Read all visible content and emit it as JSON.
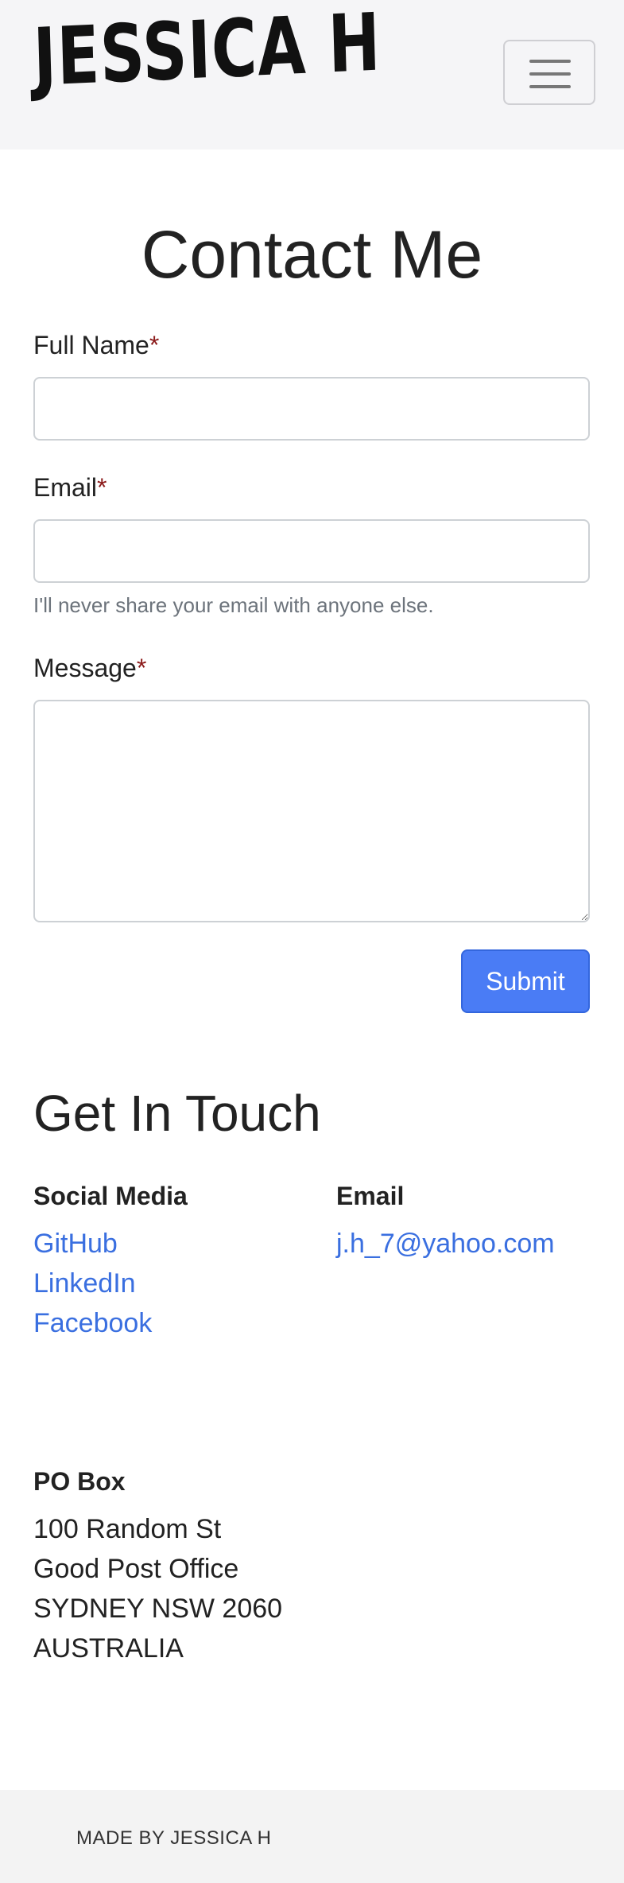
{
  "header": {
    "brand": "JESSICA H",
    "menu_icon": "hamburger-menu-icon"
  },
  "contact": {
    "title": "Contact Me",
    "required_marker": "*",
    "fields": {
      "full_name": {
        "label": "Full Name",
        "value": ""
      },
      "email": {
        "label": "Email",
        "value": "",
        "help": "I'll never share your email with anyone else."
      },
      "message": {
        "label": "Message",
        "value": ""
      }
    },
    "submit_label": "Submit"
  },
  "get_in_touch": {
    "title": "Get In Touch",
    "social": {
      "heading": "Social Media",
      "links": [
        "GitHub",
        "LinkedIn",
        "Facebook"
      ]
    },
    "email": {
      "heading": "Email",
      "address": "j.h_7@yahoo.com"
    },
    "po_box": {
      "heading": "PO Box",
      "lines": [
        "100 Random St",
        "Good Post Office",
        "SYDNEY NSW 2060",
        "AUSTRALIA"
      ]
    }
  },
  "footer": {
    "text": "MADE BY JESSICA H"
  },
  "colors": {
    "accent": "#4a7cf5",
    "link": "#3a6fe0",
    "required": "#8b1a1a",
    "navbar_bg": "#f5f5f7"
  }
}
